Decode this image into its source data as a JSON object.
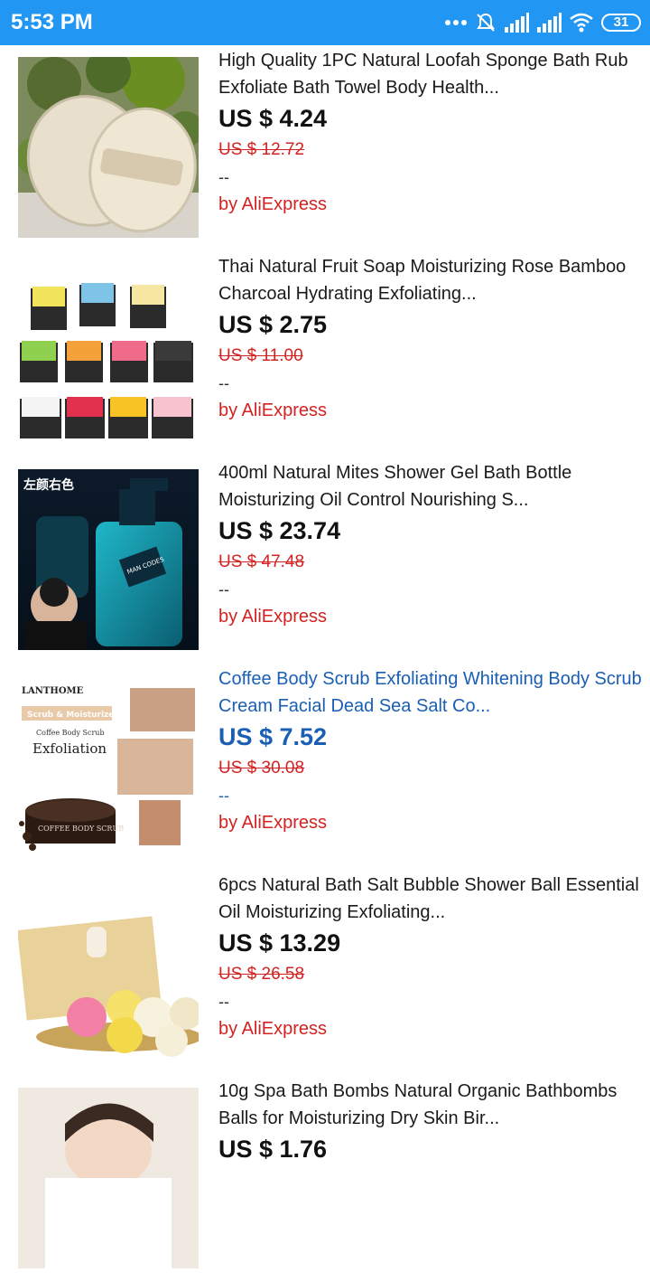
{
  "status_bar": {
    "time": "5:53 PM",
    "battery": "31",
    "icons": [
      "more-dots-icon",
      "mute-icon",
      "signal-icon",
      "signal-icon",
      "wifi-icon",
      "battery-icon"
    ]
  },
  "products": [
    {
      "title": "High Quality 1PC Natural Loofah Sponge Bath Rub Exfoliate Bath Towel Body Health...",
      "price": "US $ 4.24",
      "old_price": "US $ 12.72",
      "rating": "--",
      "seller": "by AliExpress",
      "image": "loofah-sponge-image"
    },
    {
      "title": "Thai Natural Fruit Soap Moisturizing Rose Bamboo Charcoal Hydrating Exfoliating...",
      "price": "US $ 2.75",
      "old_price": "US $ 11.00",
      "rating": "--",
      "seller": "by AliExpress",
      "image": "fruit-soap-image"
    },
    {
      "title": "400ml Natural Mites Shower Gel Bath Bottle Moisturizing Oil Control Nourishing S...",
      "price": "US $ 23.74",
      "old_price": "US $ 47.48",
      "rating": "--",
      "seller": "by AliExpress",
      "image": "shower-gel-image",
      "image_text": [
        "左颜右色",
        "MAN CODES"
      ]
    },
    {
      "title": "Coffee Body Scrub Exfoliating Whitening Body Scrub Cream Facial Dead Sea Salt Co...",
      "price": "US $ 7.52",
      "old_price": "US $ 30.08",
      "rating": "--",
      "seller": "by AliExpress",
      "visited": true,
      "image": "coffee-scrub-image",
      "image_text": [
        "LANTHOME",
        "Scrub & Moisturize",
        "Coffee Body Scrub",
        "Exfoliation",
        "COFFEE BODY SCRUB"
      ]
    },
    {
      "title": "6pcs Natural Bath Salt Bubble Shower Ball Essential Oil Moisturizing Exfoliating...",
      "price": "US $ 13.29",
      "old_price": "US $ 26.58",
      "rating": "--",
      "seller": "by AliExpress",
      "image": "bath-bombs-image"
    },
    {
      "title": "10g Spa Bath Bombs Natural Organic Bathbombs Balls for Moisturizing Dry Skin Bir...",
      "price": "US $ 1.76",
      "old_price": "",
      "rating": "",
      "seller": "",
      "image": "spa-woman-image"
    }
  ],
  "colors": {
    "status_bar": "#2196f3",
    "discount_red": "#d32222",
    "visited_blue": "#1a5fb4"
  }
}
